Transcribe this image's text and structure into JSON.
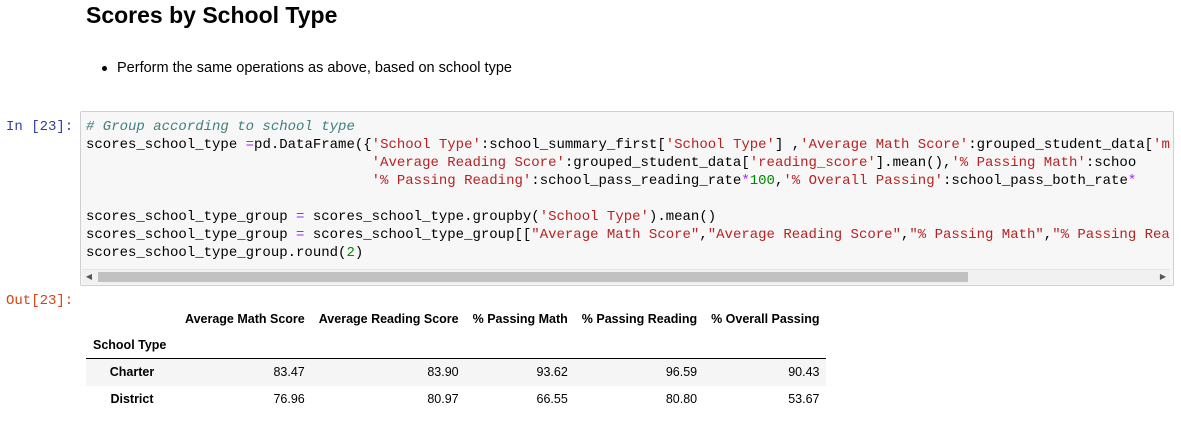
{
  "section": {
    "title": "Scores by School Type",
    "bullets": [
      "Perform the same operations as above, based on school type"
    ]
  },
  "cell": {
    "in_prompt": "In [23]:",
    "out_prompt": "Out[23]:",
    "code_lines": [
      [
        {
          "t": "# Group according to school type",
          "c": "cm"
        }
      ],
      [
        {
          "t": "scores_school_type "
        },
        {
          "t": "=",
          "c": "op"
        },
        {
          "t": "pd.DataFrame({"
        },
        {
          "t": "'School Type'",
          "c": "st"
        },
        {
          "t": ":school_summary_first["
        },
        {
          "t": "'School Type'",
          "c": "st"
        },
        {
          "t": "] ,"
        },
        {
          "t": "'Average Math Score'",
          "c": "st"
        },
        {
          "t": ":grouped_student_data["
        },
        {
          "t": "'m",
          "c": "st"
        }
      ],
      [
        {
          "t": "                                  "
        },
        {
          "t": "'Average Reading Score'",
          "c": "st"
        },
        {
          "t": ":grouped_student_data["
        },
        {
          "t": "'reading_score'",
          "c": "st"
        },
        {
          "t": "].mean(),"
        },
        {
          "t": "'% Passing Math'",
          "c": "st"
        },
        {
          "t": ":schoo"
        }
      ],
      [
        {
          "t": "                                  "
        },
        {
          "t": "'% Passing Reading'",
          "c": "st"
        },
        {
          "t": ":school_pass_reading_rate"
        },
        {
          "t": "*",
          "c": "op"
        },
        {
          "t": "100",
          "c": "nb"
        },
        {
          "t": ","
        },
        {
          "t": "'% Overall Passing'",
          "c": "st"
        },
        {
          "t": ":school_pass_both_rate"
        },
        {
          "t": "*",
          "c": "op"
        }
      ],
      [
        {
          "t": " "
        }
      ],
      [
        {
          "t": "scores_school_type_group "
        },
        {
          "t": "=",
          "c": "op"
        },
        {
          "t": " scores_school_type.groupby("
        },
        {
          "t": "'School Type'",
          "c": "st"
        },
        {
          "t": ").mean()"
        }
      ],
      [
        {
          "t": "scores_school_type_group "
        },
        {
          "t": "=",
          "c": "op"
        },
        {
          "t": " scores_school_type_group[["
        },
        {
          "t": "\"Average Math Score\"",
          "c": "st"
        },
        {
          "t": ","
        },
        {
          "t": "\"Average Reading Score\"",
          "c": "st"
        },
        {
          "t": ","
        },
        {
          "t": "\"% Passing Math\"",
          "c": "st"
        },
        {
          "t": ","
        },
        {
          "t": "\"% Passing Rea",
          "c": "st"
        }
      ],
      [
        {
          "t": "scores_school_type_group.round("
        },
        {
          "t": "2",
          "c": "nb"
        },
        {
          "t": ")"
        }
      ]
    ],
    "scroll_left_icon": "◀",
    "scroll_right_icon": "▶"
  },
  "output_table": {
    "columns": [
      "Average Math Score",
      "Average Reading Score",
      "% Passing Math",
      "% Passing Reading",
      "% Overall Passing"
    ],
    "index_name": "School Type",
    "rows": [
      {
        "index": "Charter",
        "values": [
          "83.47",
          "83.90",
          "93.62",
          "96.59",
          "90.43"
        ]
      },
      {
        "index": "District",
        "values": [
          "76.96",
          "80.97",
          "66.55",
          "80.80",
          "53.67"
        ]
      }
    ]
  }
}
